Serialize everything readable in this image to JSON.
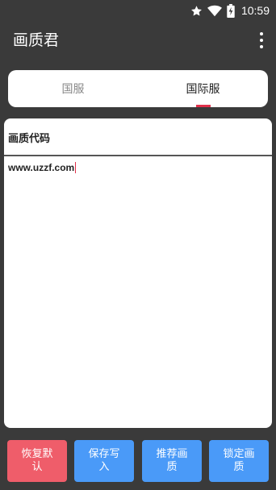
{
  "status_bar": {
    "time": "10:59",
    "icons": [
      "star-icon",
      "wifi-icon",
      "battery-charging-icon"
    ]
  },
  "app_bar": {
    "title": "画质君",
    "menu_icon": "more-vert-icon"
  },
  "tabs": [
    {
      "label": "国服",
      "active": false
    },
    {
      "label": "国际服",
      "active": true
    }
  ],
  "code_section": {
    "label": "画质代码",
    "value": "www.uzzf.com"
  },
  "buttons": [
    {
      "label": "恢复默认",
      "color": "#ef5d6a"
    },
    {
      "label": "保存写入",
      "color": "#4a9af8"
    },
    {
      "label": "推荐画质",
      "color": "#4a9af8"
    },
    {
      "label": "锁定画质",
      "color": "#4a9af8"
    }
  ],
  "colors": {
    "background": "#3a3a3a",
    "accent": "#e0304a",
    "button_blue": "#4a9af8",
    "button_red": "#ef5d6a"
  }
}
